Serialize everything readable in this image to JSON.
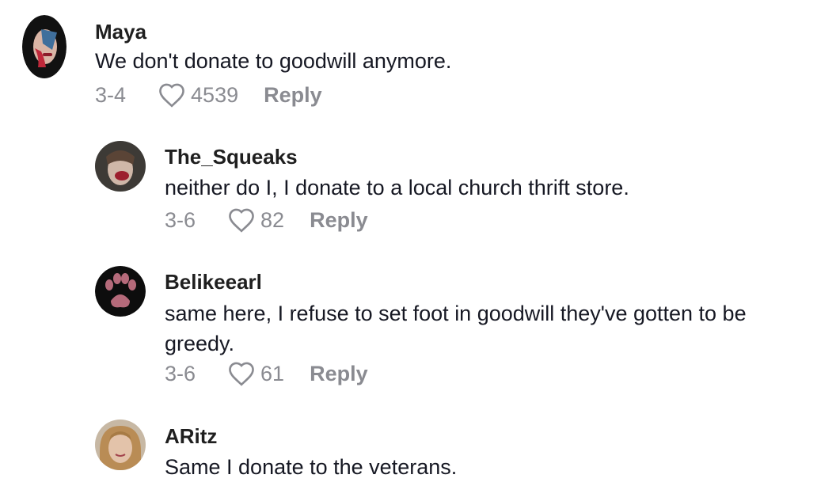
{
  "comments": [
    {
      "username": "Maya",
      "text": "We don't donate to goodwill anymore.",
      "date": "3-4",
      "likes": "4539",
      "reply_label": "Reply"
    },
    {
      "username": "The_Squeaks",
      "text": "neither do I, I donate to a local church thrift store.",
      "date": "3-6",
      "likes": "82",
      "reply_label": "Reply"
    },
    {
      "username": "Belikeearl",
      "text": "same here, I refuse to set foot in goodwill they've gotten to be greedy.",
      "date": "3-6",
      "likes": "61",
      "reply_label": "Reply"
    },
    {
      "username": "ARitz",
      "text": "Same I donate to the veterans."
    }
  ],
  "icons": {
    "like": "heart-outline-icon"
  },
  "colors": {
    "username": "#1f1f1f",
    "text": "#161823",
    "meta": "#8a8b91"
  }
}
